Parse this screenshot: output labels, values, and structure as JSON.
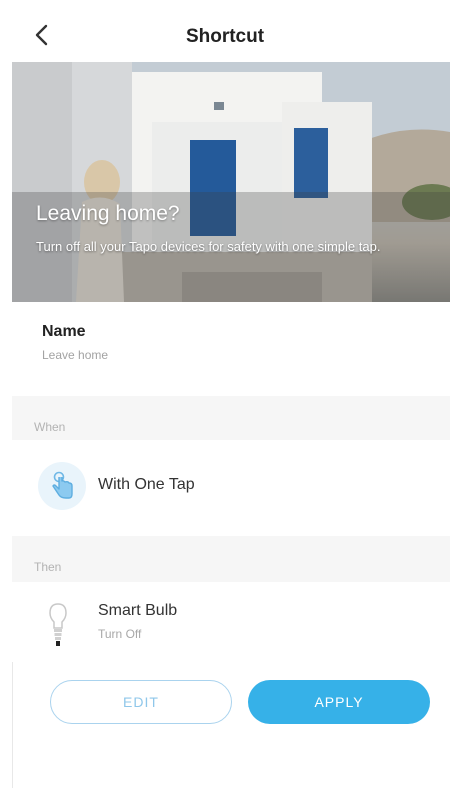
{
  "header": {
    "title": "Shortcut",
    "back_icon": "chevron-left-icon"
  },
  "hero": {
    "title": "Leaving home?",
    "subtitle": "Turn off all your Tapo devices for safety with one simple tap."
  },
  "name": {
    "label": "Name",
    "value": "Leave home"
  },
  "when": {
    "section_label": "When",
    "trigger": "With One Tap",
    "icon": "tap-hand-icon"
  },
  "then": {
    "section_label": "Then",
    "items": [
      {
        "device": "Smart Bulb",
        "action": "Turn Off",
        "icon": "light-bulb-icon"
      }
    ]
  },
  "actions": {
    "edit_label": "EDIT",
    "apply_label": "APPLY"
  },
  "colors": {
    "accent": "#36b1e8",
    "accent_light": "#aad3ee",
    "door_blue": "#245a9a"
  }
}
